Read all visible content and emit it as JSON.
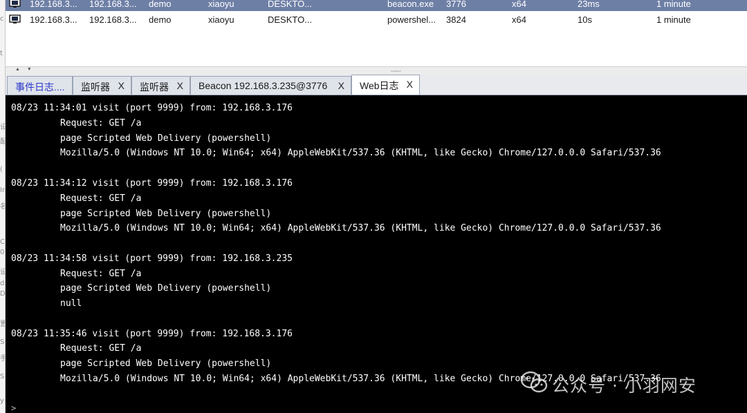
{
  "left_edge_glyphs": [
    "c",
    "t",
    "设",
    "配",
    "(",
    "In",
    "名",
    "C",
    "0",
    "设",
    "d",
    "D",
    "置",
    "S",
    "手",
    "S",
    "y"
  ],
  "sessions": {
    "rows": [
      {
        "external": "192.168.3...",
        "internal": "192.168.3...",
        "listener": "demo",
        "user": "xiaoyu",
        "computer": "DESKTO...",
        "process": "beacon.exe",
        "pid": "3776",
        "arch": "x64",
        "last": "23ms",
        "sleep": "1 minute"
      },
      {
        "external": "192.168.3...",
        "internal": "192.168.3...",
        "listener": "demo",
        "user": "xiaoyu",
        "computer": "DESKTO...",
        "process": "powershel...",
        "pid": "3824",
        "arch": "x64",
        "last": "10s",
        "sleep": "1 minute"
      }
    ]
  },
  "splitter": {
    "arrows": "▲ ▼",
    "grip": "〰〰"
  },
  "tabs": [
    {
      "label": "事件日志....",
      "close": ""
    },
    {
      "label": "监听器",
      "close": "X"
    },
    {
      "label": "监听器",
      "close": "X"
    },
    {
      "label": "Beacon 192.168.3.235@3776",
      "close": "X"
    },
    {
      "label": "Web日志",
      "close": "X"
    }
  ],
  "console": {
    "entries": [
      {
        "head": "08/23 11:34:01 visit (port 9999) from: 192.168.3.176",
        "lines": [
          "Request: GET /a",
          "page Scripted Web Delivery (powershell)",
          "Mozilla/5.0 (Windows NT 10.0; Win64; x64) AppleWebKit/537.36 (KHTML, like Gecko) Chrome/127.0.0.0 Safari/537.36"
        ]
      },
      {
        "head": "08/23 11:34:12 visit (port 9999) from: 192.168.3.176",
        "lines": [
          "Request: GET /a",
          "page Scripted Web Delivery (powershell)",
          "Mozilla/5.0 (Windows NT 10.0; Win64; x64) AppleWebKit/537.36 (KHTML, like Gecko) Chrome/127.0.0.0 Safari/537.36"
        ]
      },
      {
        "head": "08/23 11:34:58 visit (port 9999) from: 192.168.3.235",
        "lines": [
          "Request: GET /a",
          "page Scripted Web Delivery (powershell)",
          "null"
        ]
      },
      {
        "head": "08/23 11:35:46 visit (port 9999) from: 192.168.3.176",
        "lines": [
          "Request: GET /a",
          "page Scripted Web Delivery (powershell)",
          "Mozilla/5.0 (Windows NT 10.0; Win64; x64) AppleWebKit/537.36 (KHTML, like Gecko) Chrome/127.0.0.0 Safari/537.36"
        ]
      }
    ],
    "prompt": ">"
  },
  "watermark": {
    "text": "公众号 · 小羽网安",
    "icon": "wechat-icon"
  },
  "colors": {
    "selected_row": "#6e7fa6",
    "console_bg": "#000000",
    "console_fg": "#ffffff",
    "first_tab_text": "#2b39c9"
  }
}
